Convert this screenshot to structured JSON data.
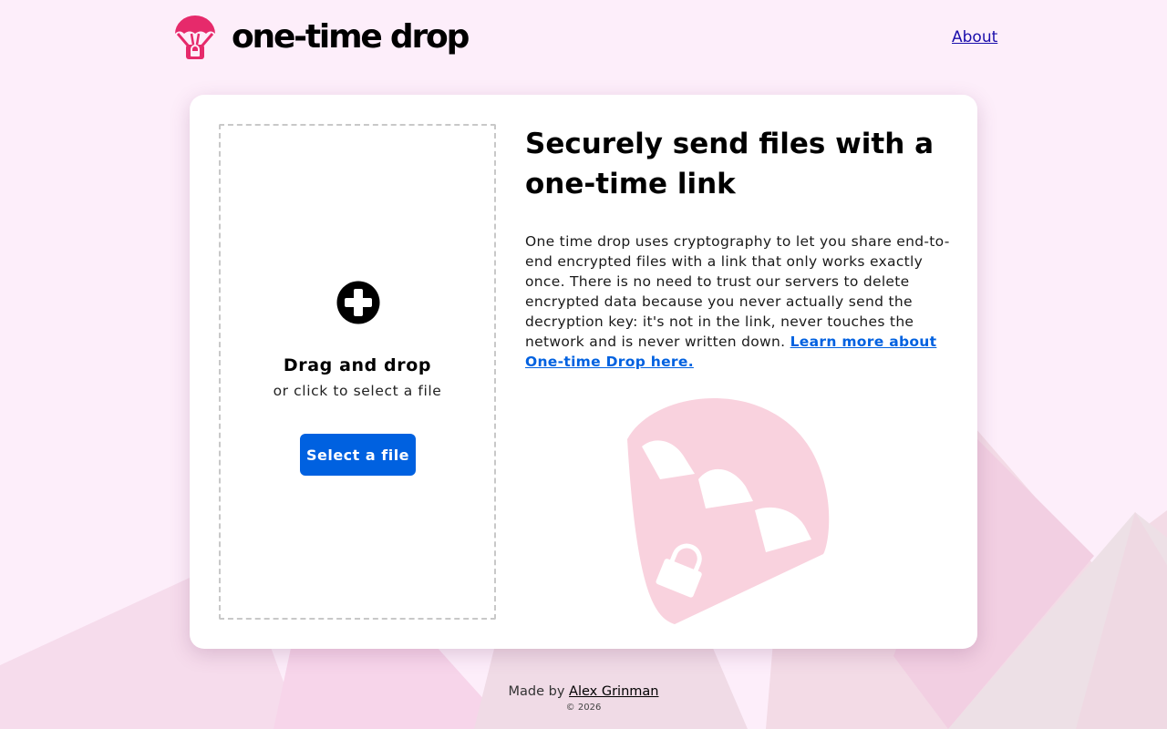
{
  "header": {
    "brand_name": "one-time drop",
    "logo_icon": "parachute-lock-icon",
    "about_label": "About"
  },
  "upload": {
    "icon": "plus-circle-icon",
    "title": "Drag and drop",
    "subtitle": "or click to select a file",
    "button_label": "Select a file"
  },
  "info": {
    "headline": "Securely send files with a one-time link",
    "description": "One time drop uses cryptography to let you share end-to-end encrypted files with a link that only works exactly once. There is no need to trust our servers to delete encrypted data because you never actually send the decryption key: it's not in the link, never touches the network and is never written down.",
    "learn_more_label": "Learn more about One-time Drop here.",
    "illustration": "parachute-lock-illustration"
  },
  "footer": {
    "made_by_prefix": "Made by",
    "author": "Alex Grinman",
    "copyright": "© 2026"
  },
  "colors": {
    "background": "#fdeefa",
    "brand_pink": "#e62a6b",
    "primary_button": "#0061e0",
    "link_blue": "#0061e0",
    "illustration_pink": "#f9d2de"
  }
}
